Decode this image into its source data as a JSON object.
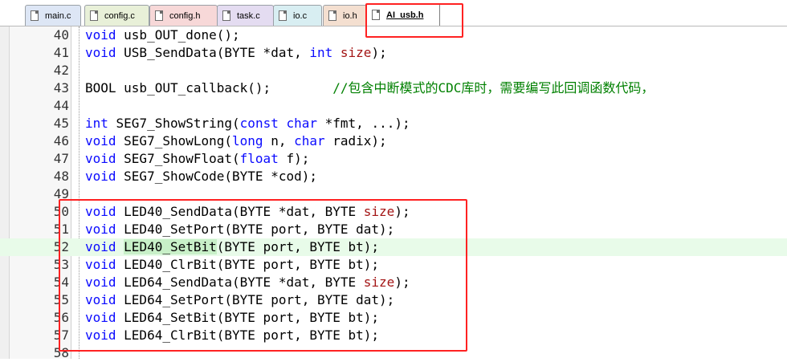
{
  "tabs": [
    {
      "label": "main.c",
      "bg": "#dde6f5"
    },
    {
      "label": "config.c",
      "bg": "#e8f0d8"
    },
    {
      "label": "config.h",
      "bg": "#f7d8d8"
    },
    {
      "label": "task.c",
      "bg": "#e4dcf1"
    },
    {
      "label": "io.c",
      "bg": "#d8eef2"
    },
    {
      "label": "io.h",
      "bg": "#f4dfd0"
    },
    {
      "label": "AI_usb.h",
      "bg": "#ffffff",
      "active": true
    }
  ],
  "highlight_color": "#e8fbe9",
  "annotation_color": "#ff2222",
  "lines": [
    {
      "n": "40",
      "tokens": [
        {
          "t": "void",
          "c": "kw"
        },
        {
          "t": " usb_OUT_done();",
          "c": "pr"
        }
      ]
    },
    {
      "n": "41",
      "tokens": [
        {
          "t": "void",
          "c": "kw"
        },
        {
          "t": " USB_SendData(BYTE *dat, ",
          "c": "pr"
        },
        {
          "t": "int",
          "c": "kw"
        },
        {
          "t": " ",
          "c": "pr"
        },
        {
          "t": "size",
          "c": "sz"
        },
        {
          "t": ");",
          "c": "pr"
        }
      ]
    },
    {
      "n": "42",
      "tokens": []
    },
    {
      "n": "43",
      "tokens": [
        {
          "t": "BOOL usb_OUT_callback();        ",
          "c": "pr"
        },
        {
          "t": "//包含中断模式的CDC库时，需要编写此回调函数代码，",
          "c": "cm"
        }
      ]
    },
    {
      "n": "44",
      "tokens": []
    },
    {
      "n": "45",
      "tokens": [
        {
          "t": "int",
          "c": "kw"
        },
        {
          "t": " SEG7_ShowString(",
          "c": "pr"
        },
        {
          "t": "const",
          "c": "kw"
        },
        {
          "t": " ",
          "c": "pr"
        },
        {
          "t": "char",
          "c": "kw"
        },
        {
          "t": " *fmt, ...);",
          "c": "pr"
        }
      ]
    },
    {
      "n": "46",
      "tokens": [
        {
          "t": "void",
          "c": "kw"
        },
        {
          "t": " SEG7_ShowLong(",
          "c": "pr"
        },
        {
          "t": "long",
          "c": "kw"
        },
        {
          "t": " n, ",
          "c": "pr"
        },
        {
          "t": "char",
          "c": "kw"
        },
        {
          "t": " radix);",
          "c": "pr"
        }
      ]
    },
    {
      "n": "47",
      "tokens": [
        {
          "t": "void",
          "c": "kw"
        },
        {
          "t": " SEG7_ShowFloat(",
          "c": "pr"
        },
        {
          "t": "float",
          "c": "kw"
        },
        {
          "t": " f);",
          "c": "pr"
        }
      ]
    },
    {
      "n": "48",
      "tokens": [
        {
          "t": "void",
          "c": "kw"
        },
        {
          "t": " SEG7_ShowCode(BYTE *cod);",
          "c": "pr"
        }
      ]
    },
    {
      "n": "49",
      "tokens": []
    },
    {
      "n": "50",
      "tokens": [
        {
          "t": "void",
          "c": "kw"
        },
        {
          "t": " LED40_SendData(BYTE *dat, BYTE ",
          "c": "pr"
        },
        {
          "t": "size",
          "c": "sz"
        },
        {
          "t": ");",
          "c": "pr"
        }
      ]
    },
    {
      "n": "51",
      "tokens": [
        {
          "t": "void",
          "c": "kw"
        },
        {
          "t": " LED40_SetPort(BYTE port, BYTE dat);",
          "c": "pr"
        }
      ]
    },
    {
      "n": "52",
      "hl": true,
      "tokens": [
        {
          "t": "void",
          "c": "kw"
        },
        {
          "t": " ",
          "c": "pr"
        },
        {
          "t": "LED40_SetBit",
          "c": "hl"
        },
        {
          "t": "(BYTE port, BYTE bt);",
          "c": "pr"
        }
      ]
    },
    {
      "n": "53",
      "tokens": [
        {
          "t": "void",
          "c": "kw"
        },
        {
          "t": " LED40_ClrBit(BYTE port, BYTE bt);",
          "c": "pr"
        }
      ]
    },
    {
      "n": "54",
      "tokens": [
        {
          "t": "void",
          "c": "kw"
        },
        {
          "t": " LED64_SendData(BYTE *dat, BYTE ",
          "c": "pr"
        },
        {
          "t": "size",
          "c": "sz"
        },
        {
          "t": ");",
          "c": "pr"
        }
      ]
    },
    {
      "n": "55",
      "tokens": [
        {
          "t": "void",
          "c": "kw"
        },
        {
          "t": " LED64_SetPort(BYTE port, BYTE dat);",
          "c": "pr"
        }
      ]
    },
    {
      "n": "56",
      "tokens": [
        {
          "t": "void",
          "c": "kw"
        },
        {
          "t": " LED64_SetBit(BYTE port, BYTE bt);",
          "c": "pr"
        }
      ]
    },
    {
      "n": "57",
      "tokens": [
        {
          "t": "void",
          "c": "kw"
        },
        {
          "t": " LED64_ClrBit(BYTE port, BYTE bt);",
          "c": "pr"
        }
      ]
    },
    {
      "n": "58",
      "tokens": []
    }
  ]
}
